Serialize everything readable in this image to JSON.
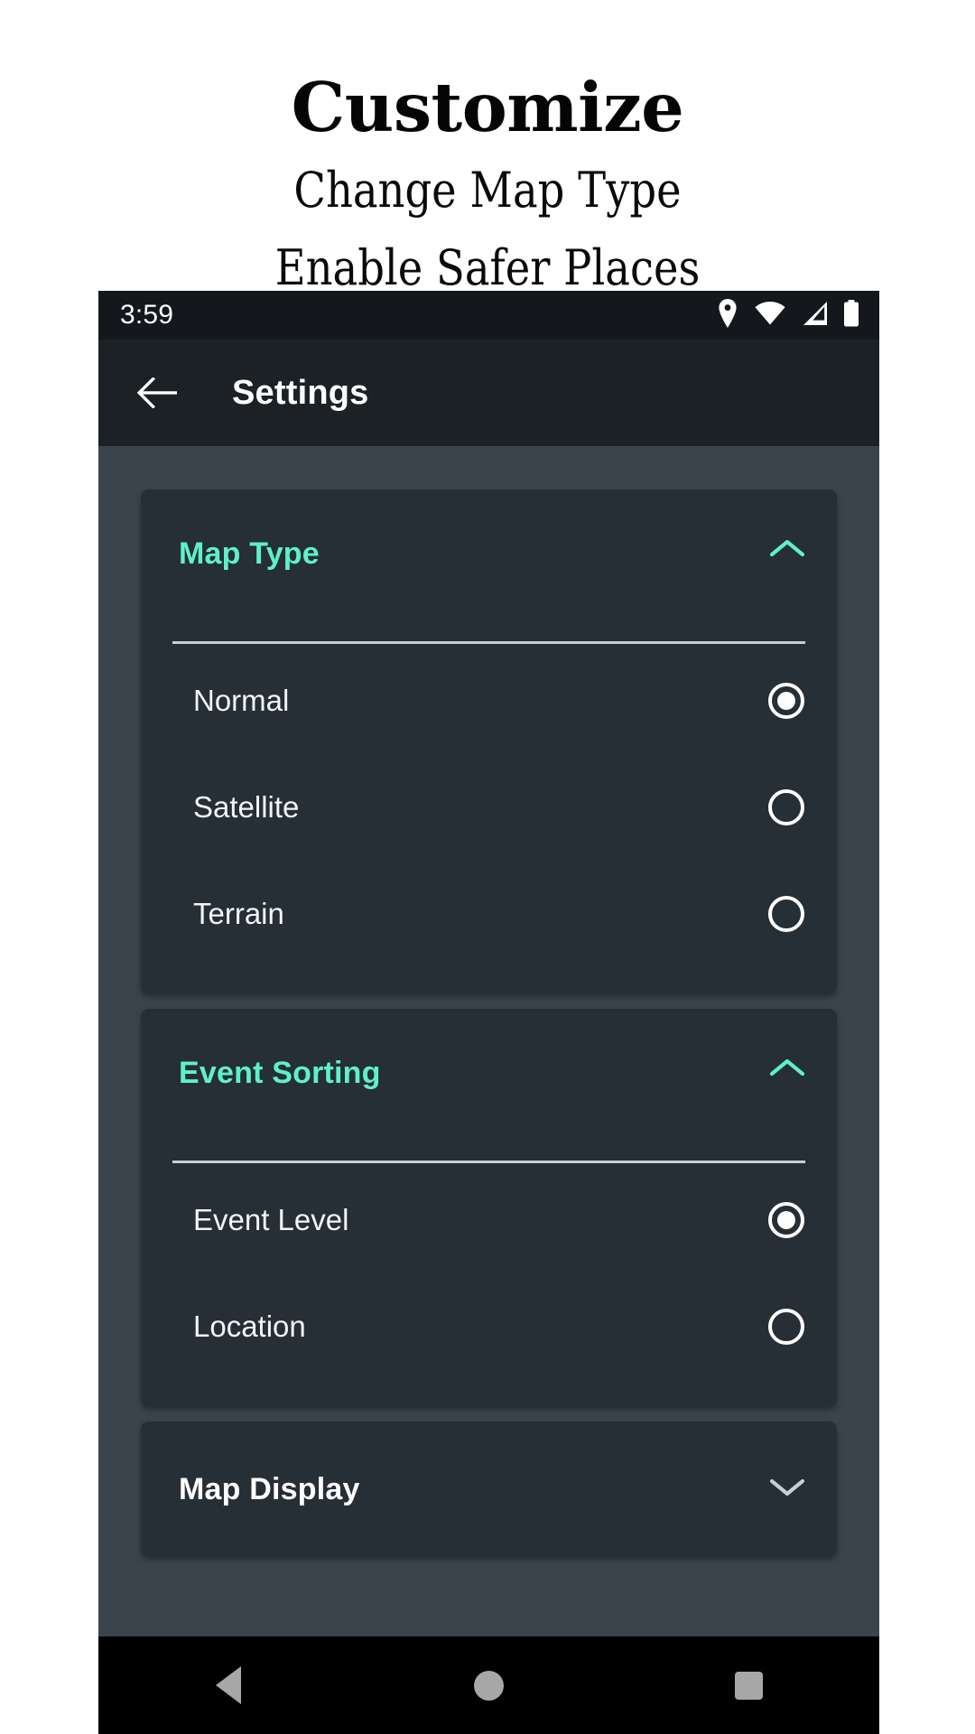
{
  "promo": {
    "title": "Customize",
    "subtitle_line1": "Change Map Type",
    "subtitle_line2": "Enable Safer Places"
  },
  "colors": {
    "accent": "#5ff0cb",
    "card_bg": "#262e36",
    "page_bg": "#39444d",
    "appbar_bg": "#1c2126",
    "statusbar_bg": "#14181c",
    "text_primary": "#ffffff"
  },
  "statusbar": {
    "time": "3:59",
    "icons": [
      "location-pin-icon",
      "wifi-icon",
      "signal-icon",
      "battery-icon"
    ]
  },
  "appbar": {
    "back_icon": "back-arrow-icon",
    "title": "Settings"
  },
  "sections": [
    {
      "id": "map-type",
      "title": "Map Type",
      "expanded": true,
      "chevron": "chevron-up-icon",
      "options": [
        {
          "label": "Normal",
          "selected": true
        },
        {
          "label": "Satellite",
          "selected": false
        },
        {
          "label": "Terrain",
          "selected": false
        }
      ]
    },
    {
      "id": "event-sorting",
      "title": "Event Sorting",
      "expanded": true,
      "chevron": "chevron-up-icon",
      "options": [
        {
          "label": "Event Level",
          "selected": true
        },
        {
          "label": "Location",
          "selected": false
        }
      ]
    },
    {
      "id": "map-display",
      "title": "Map Display",
      "expanded": false,
      "chevron": "chevron-down-icon",
      "options": []
    }
  ],
  "navbar": {
    "back": "nav-back-icon",
    "home": "nav-home-icon",
    "recents": "nav-recents-icon"
  }
}
